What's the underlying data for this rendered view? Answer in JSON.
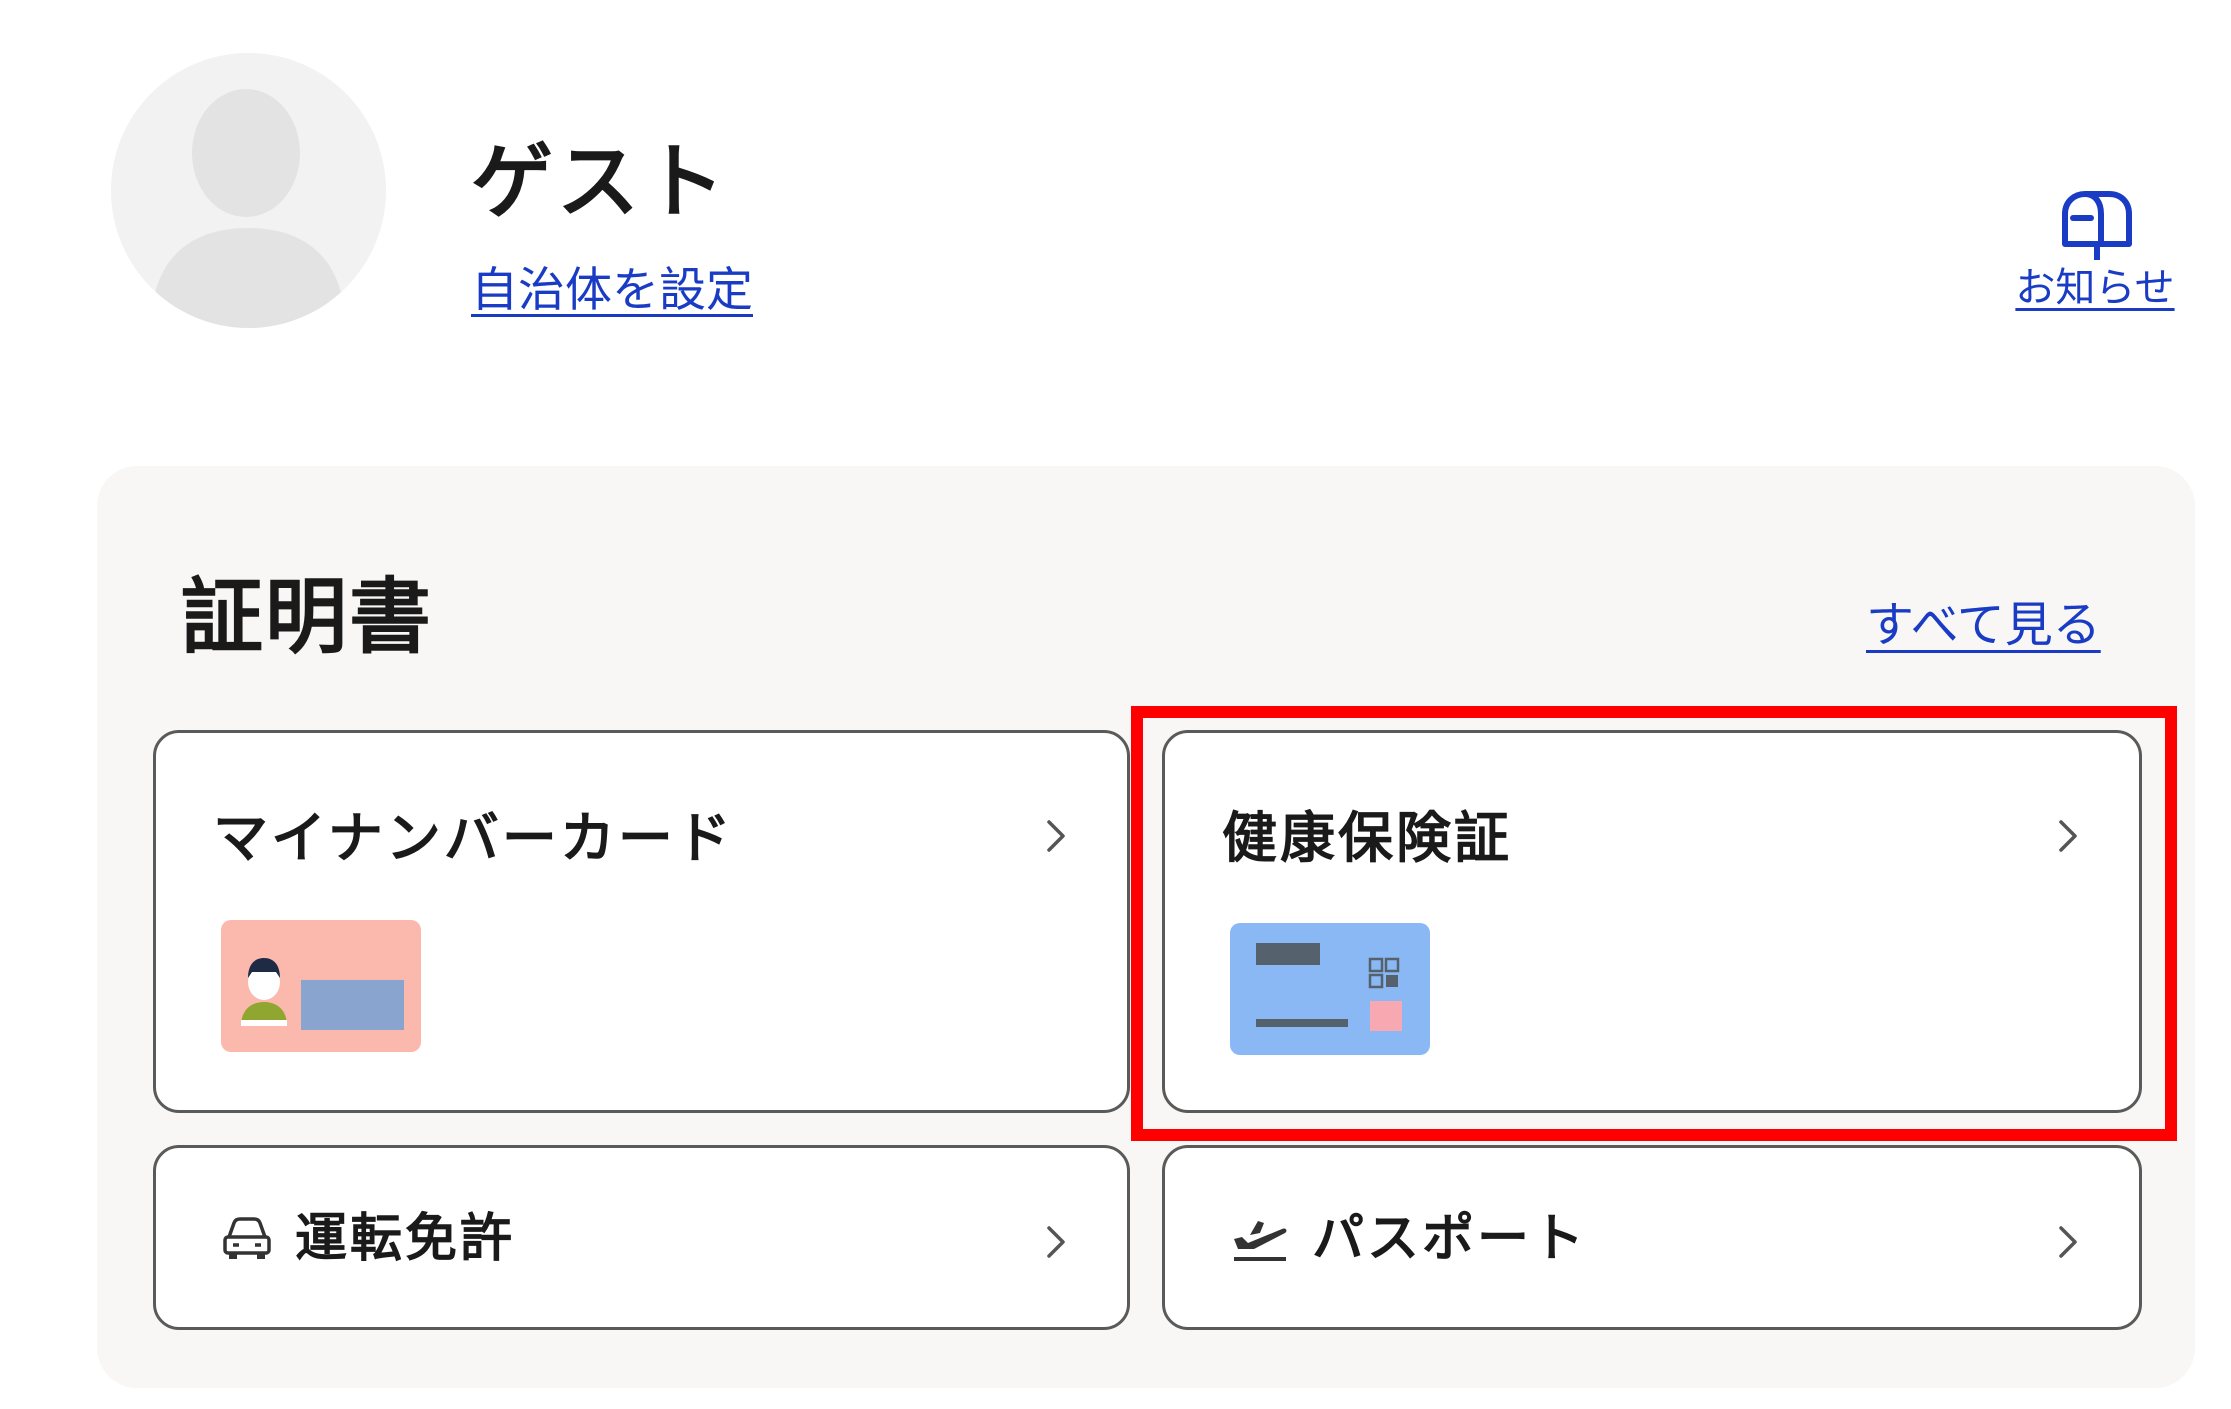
{
  "header": {
    "user_name": "ゲスト",
    "set_municipality_link": "自治体を設定",
    "notice_label": "お知らせ"
  },
  "certificates": {
    "title": "証明書",
    "see_all_link": "すべて見る",
    "cards": [
      {
        "label": "マイナンバーカード",
        "icon": "my-number-card-illustration"
      },
      {
        "label": "健康保険証",
        "icon": "health-insurance-card-illustration"
      },
      {
        "label": "運転免許",
        "icon": "car-icon"
      },
      {
        "label": "パスポート",
        "icon": "airplane-takeoff-icon"
      }
    ]
  },
  "colors": {
    "link": "#1a3cc4",
    "panel_background": "#f8f7f5",
    "card_border": "#5a5a5a",
    "highlight": "#ff0000",
    "my_number_card": "#fbb8ad",
    "health_card": "#8ab8f4"
  }
}
